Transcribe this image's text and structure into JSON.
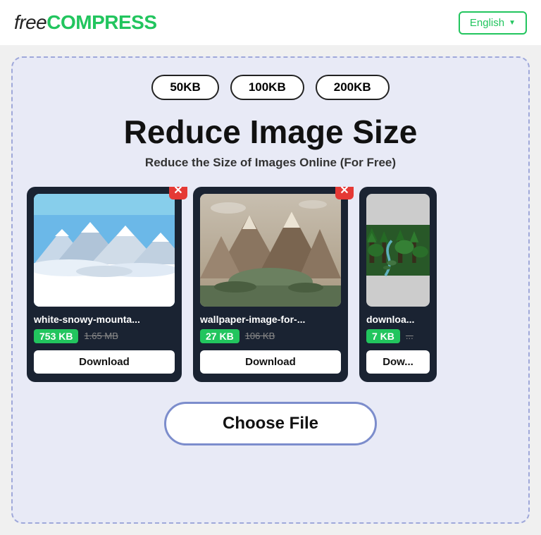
{
  "header": {
    "logo_free": "free",
    "logo_compress": "COMPRESS",
    "lang_button": "English",
    "lang_chevron": "▼"
  },
  "main": {
    "size_options": [
      "50KB",
      "100KB",
      "200KB"
    ],
    "title": "Reduce Image Size",
    "subtitle": "Reduce the Size of Images Online (For Free)",
    "cards": [
      {
        "filename": "white-snowy-mounta...",
        "size_new": "753 KB",
        "size_old": "1.65 MB",
        "download_label": "Download"
      },
      {
        "filename": "wallpaper-image-for-...",
        "size_new": "27 KB",
        "size_old": "106 KB",
        "download_label": "Download"
      },
      {
        "filename": "downloa...",
        "size_new": "7 KB",
        "size_old": "...",
        "download_label": "Dow..."
      }
    ],
    "choose_file_label": "Choose File"
  }
}
